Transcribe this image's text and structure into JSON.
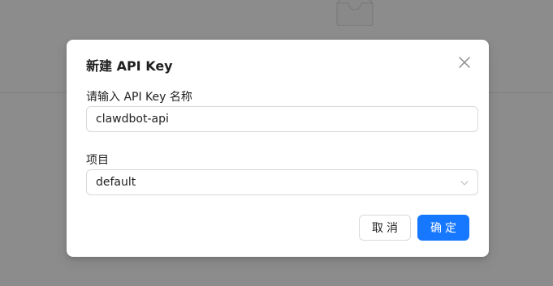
{
  "modal": {
    "title": "新建 API Key",
    "name_label": "请输入 API Key 名称",
    "name_value": "clawdbot-api",
    "project_label": "项目",
    "project_value": "default",
    "cancel_label": "取消",
    "ok_label": "确定",
    "close_icon": "close-icon"
  },
  "colors": {
    "primary": "#1677ff",
    "mask": "rgba(0,0,0,0.45)"
  }
}
